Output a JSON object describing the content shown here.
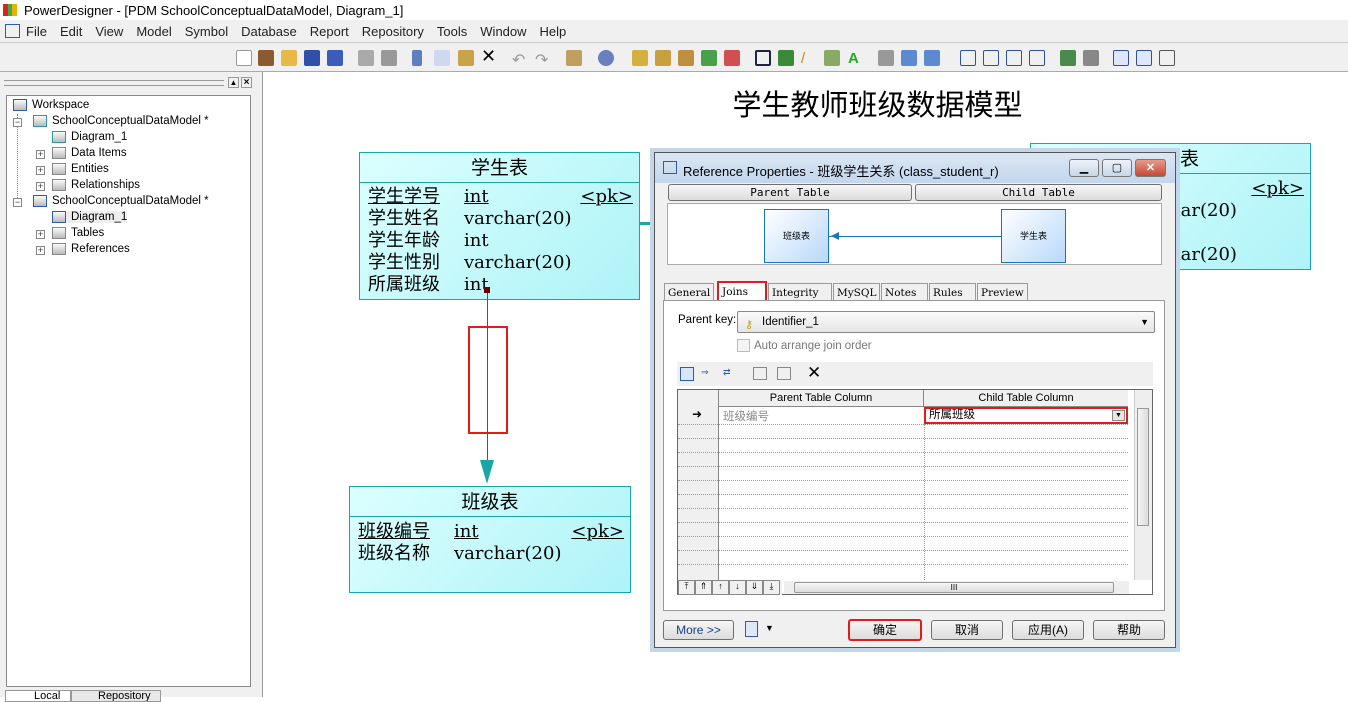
{
  "window": {
    "title": "PowerDesigner - [PDM SchoolConceptualDataModel, Diagram_1]"
  },
  "menu": [
    "File",
    "Edit",
    "View",
    "Model",
    "Symbol",
    "Database",
    "Report",
    "Repository",
    "Tools",
    "Window",
    "Help"
  ],
  "browser": {
    "tree": [
      {
        "label": "Workspace",
        "icon": "workspace-icon"
      },
      {
        "label": "SchoolConceptualDataModel *",
        "icon": "cdm-model-icon"
      },
      {
        "label": "Diagram_1",
        "icon": "diagram-icon"
      },
      {
        "label": "Data Items",
        "icon": "folder-icon"
      },
      {
        "label": "Entities",
        "icon": "folder-icon"
      },
      {
        "label": "Relationships",
        "icon": "folder-icon"
      },
      {
        "label": "SchoolConceptualDataModel *",
        "icon": "pdm-model-icon"
      },
      {
        "label": "Diagram_1",
        "icon": "diagram-icon"
      },
      {
        "label": "Tables",
        "icon": "folder-icon"
      },
      {
        "label": "References",
        "icon": "folder-icon"
      }
    ],
    "tabs": [
      "Local",
      "Repository"
    ]
  },
  "diagram": {
    "title": "学生教师班级数据模型",
    "student": {
      "name": "学生表",
      "columns": [
        {
          "name": "学生学号",
          "type": "int",
          "pk": "<pk>"
        },
        {
          "name": "学生姓名",
          "type": "varchar(20)"
        },
        {
          "name": "学生年龄",
          "type": "int"
        },
        {
          "name": "学生性别",
          "type": "varchar(20)"
        },
        {
          "name": "所属班级",
          "type": "int"
        }
      ]
    },
    "class": {
      "name": "班级表",
      "columns": [
        {
          "name": "班级编号",
          "type": "int",
          "pk": "<pk>"
        },
        {
          "name": "班级名称",
          "type": "varchar(20)"
        }
      ]
    },
    "teacher": {
      "name": "教师表",
      "pk": "<pk>",
      "types": [
        "char(20)",
        "char(20)"
      ]
    }
  },
  "dialog": {
    "title": "Reference Properties - 班级学生关系 (class_student_r)",
    "parent_table_label": "Parent Table",
    "child_table_label": "Child Table",
    "parent_table": "班级表",
    "child_table": "学生表",
    "tabs": [
      "General",
      "Joins",
      "Integrity",
      "MySQL",
      "Notes",
      "Rules",
      "Preview"
    ],
    "active_tab": "Joins",
    "parent_key_label": "Parent key:",
    "parent_key_value": "Identifier_1",
    "auto_arrange_label": "Auto arrange join order",
    "auto_arrange_checked": false,
    "grid": {
      "headers": [
        "Parent Table Column",
        "Child Table Column"
      ],
      "rows": [
        {
          "parent": "班级编号",
          "child": "所属班级"
        }
      ]
    },
    "scroll_glyph": "III",
    "buttons": {
      "more": "More >>",
      "ok": "确定",
      "cancel": "取消",
      "apply": "应用(A)",
      "help": "帮助"
    }
  },
  "colors": {
    "entity_fill": "#bff7f9",
    "entity_border": "#1aa6a8",
    "highlight": "#e21b1b",
    "link": "#1aa6a8"
  }
}
